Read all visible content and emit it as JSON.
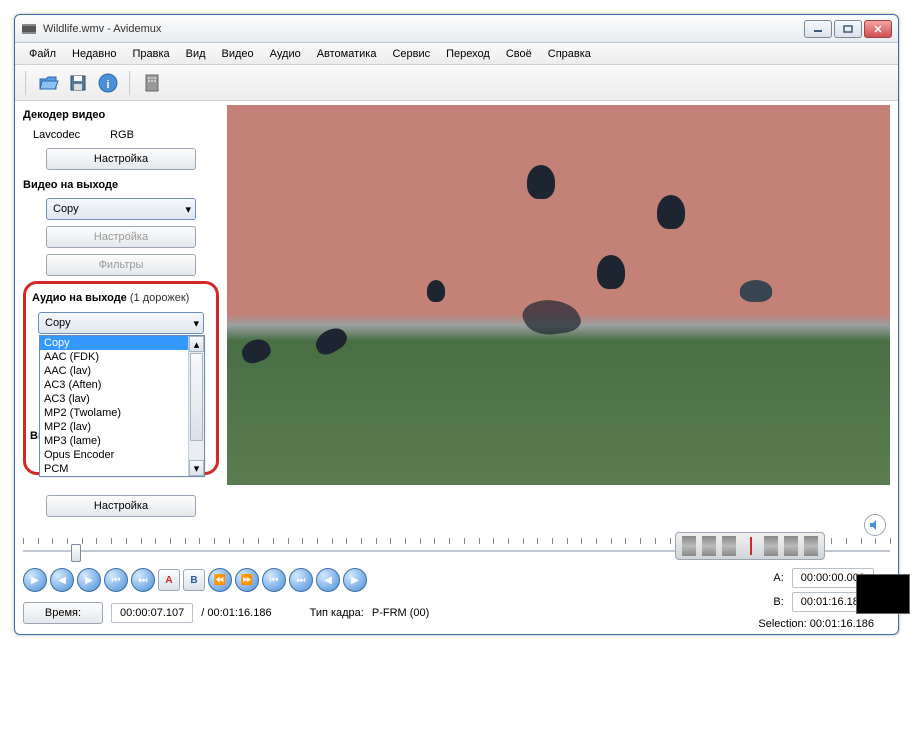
{
  "window": {
    "title": "Wildlife.wmv - Avidemux"
  },
  "menu": {
    "file": "Файл",
    "recent": "Недавно",
    "edit": "Правка",
    "view": "Вид",
    "video": "Видео",
    "audio": "Аудио",
    "auto": "Автоматика",
    "service": "Сервис",
    "go": "Переход",
    "custom": "Своё",
    "help": "Справка"
  },
  "sidebar": {
    "decoder_title": "Декодер видео",
    "lavcodec": "Lavcodec",
    "rgb": "RGB",
    "settings_btn": "Настройка",
    "video_out_title": "Видео на выходе",
    "video_codec": "Copy",
    "filters_btn": "Фильтры",
    "audio_out_title": "Аудио на выходе",
    "audio_tracks": "(1 дорожек)",
    "audio_codec": "Copy",
    "audio_options": [
      "Copy",
      "AAC (FDK)",
      "AAC (lav)",
      "AC3 (Aften)",
      "AC3 (lav)",
      "MP2 (Twolame)",
      "MP2 (lav)",
      "MP3 (lame)",
      "Opus Encoder",
      "PCM"
    ],
    "out_prefix": "Вы"
  },
  "bottom": {
    "settings_btn": "Настройка",
    "time_label": "Время:",
    "time_current": "00:00:07.107",
    "time_total": "/ 00:01:16.186",
    "frame_type_label": "Тип кадра:",
    "frame_type": "P-FRM (00)",
    "a_label": "A:",
    "a_value": "00:00:00.000",
    "b_label": "B:",
    "b_value": "00:01:16.186",
    "selection_label": "Selection: 00:01:16.186"
  }
}
